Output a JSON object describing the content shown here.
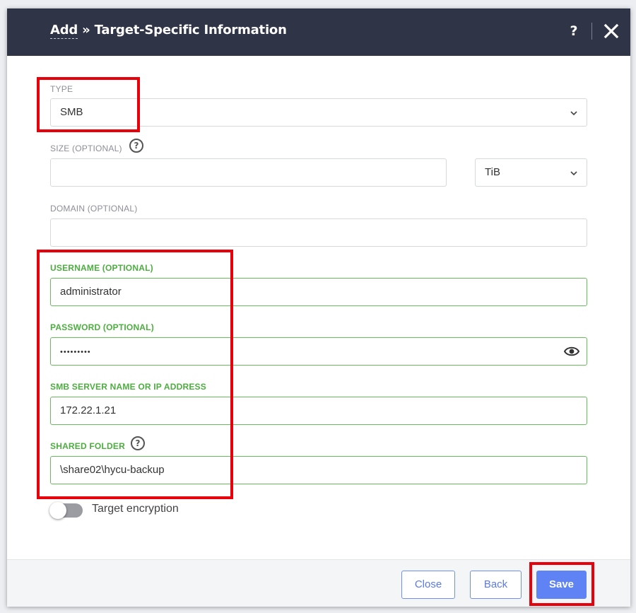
{
  "header": {
    "title_link": "Add",
    "title_separator": " » ",
    "title_rest": "Target-Specific Information",
    "help_label": "?",
    "help_icon": "question-icon",
    "close_icon": "close-icon"
  },
  "form": {
    "type": {
      "label": "TYPE",
      "value": "SMB"
    },
    "size": {
      "label": "SIZE (OPTIONAL)",
      "value": "",
      "unit": "TiB"
    },
    "domain": {
      "label": "DOMAIN (OPTIONAL)",
      "value": ""
    },
    "username": {
      "label": "USERNAME (OPTIONAL)",
      "value": "administrator"
    },
    "password": {
      "label": "PASSWORD (OPTIONAL)",
      "masked": "•••••••••"
    },
    "server": {
      "label": "SMB SERVER NAME OR IP ADDRESS",
      "value": "172.22.1.21"
    },
    "shared_folder": {
      "label": "SHARED FOLDER",
      "value": "\\share02\\hycu-backup"
    },
    "encryption": {
      "label": "Target encryption",
      "enabled": false
    }
  },
  "footer": {
    "close_label": "Close",
    "back_label": "Back",
    "save_label": "Save"
  },
  "colors": {
    "header_bg": "#2f3447",
    "accent_blue": "#5f83f4",
    "valid_green": "#66bd5a",
    "highlight_red": "#e8000b"
  }
}
